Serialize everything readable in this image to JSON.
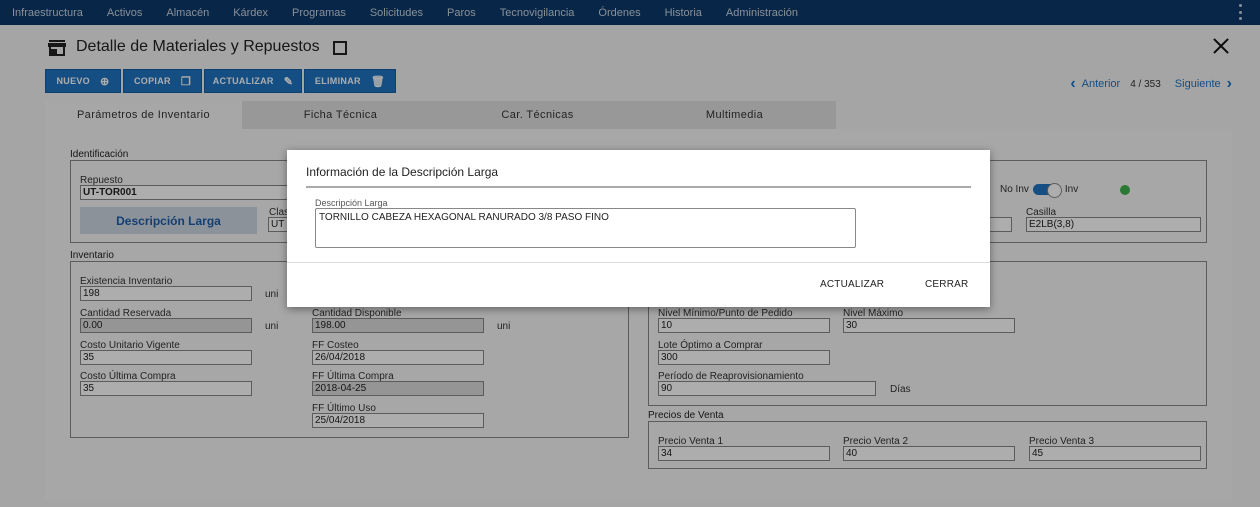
{
  "nav": {
    "items": [
      "Infraestructura",
      "Activos",
      "Almacén",
      "Kárdex",
      "Programas",
      "Solicitudes",
      "Paros",
      "Tecnovigilancia",
      "Órdenes",
      "Historia",
      "Administración"
    ],
    "more_icon": "kebab-vertical-icon"
  },
  "header": {
    "title": "Detalle de Materiales y Repuestos",
    "icon": "store-icon"
  },
  "toolbar": {
    "new_label": "NUEVO",
    "copy_label": "COPIAR",
    "update_label": "ACTUALIZAR",
    "delete_label": "ELIMINAR"
  },
  "pager": {
    "prev_label": "Anterior",
    "count": "4 / 353",
    "next_label": "Siguiente"
  },
  "tabs": [
    "Parámetros de Inventario",
    "Ficha Técnica",
    "Car. Técnicas",
    "Multimedia"
  ],
  "identificacion": {
    "group_label": "Identificación",
    "repuesto_label": "Repuesto",
    "repuesto_value": "UT-TOR001",
    "descripcion_button": "Descripción Larga",
    "clase_label_partial": "Clas",
    "clase_value_partial": "UT",
    "toggle_off_label": "No Inv",
    "toggle_on_label": "Inv",
    "casilla_label": "Casilla",
    "casilla_value": "E2LB(3,8)"
  },
  "inventario": {
    "group_label": "Inventario",
    "existencia_label": "Existencia Inventario",
    "existencia_value": "198",
    "unit": "uni",
    "reservada_label": "Cantidad Reservada",
    "reservada_value": "0.00",
    "disponible_label": "Cantidad Disponible",
    "disponible_value": "198.00",
    "costo_unit_label": "Costo Unitario Vigente",
    "costo_unit_value": "35",
    "ff_costeo_label": "FF Costeo",
    "ff_costeo_value": "26/04/2018",
    "costo_ultima_label": "Costo Última Compra",
    "costo_ultima_value": "35",
    "ff_ultima_compra_label": "FF Última Compra",
    "ff_ultima_compra_value": "2018-04-25",
    "ff_ultimo_uso_label": "FF Último Uso",
    "ff_ultimo_uso_value": "25/04/2018"
  },
  "reposicion": {
    "nivel_min_label": "Nivel Mínimo/Punto de Pedido",
    "nivel_min_value": "10",
    "nivel_max_label": "Nivel Máximo",
    "nivel_max_value": "30",
    "lote_label": "Lote Óptimo a Comprar",
    "lote_value": "300",
    "periodo_label": "Período de Reaprovisionamiento",
    "periodo_value": "90",
    "dias_label": "Días"
  },
  "precios": {
    "group_label": "Precios de Venta",
    "p1_label": "Precio Venta 1",
    "p1_value": "34",
    "p2_label": "Precio Venta 2",
    "p2_value": "40",
    "p3_label": "Precio Venta 3",
    "p3_value": "45"
  },
  "modal": {
    "title": "Información de la Descripción Larga",
    "field_label": "Descripción Larga",
    "field_value": "TORNILLO CABEZA HEXAGONAL RANURADO 3/8 PASO FINO",
    "update_label": "ACTUALIZAR",
    "close_label": "CERRAR"
  }
}
